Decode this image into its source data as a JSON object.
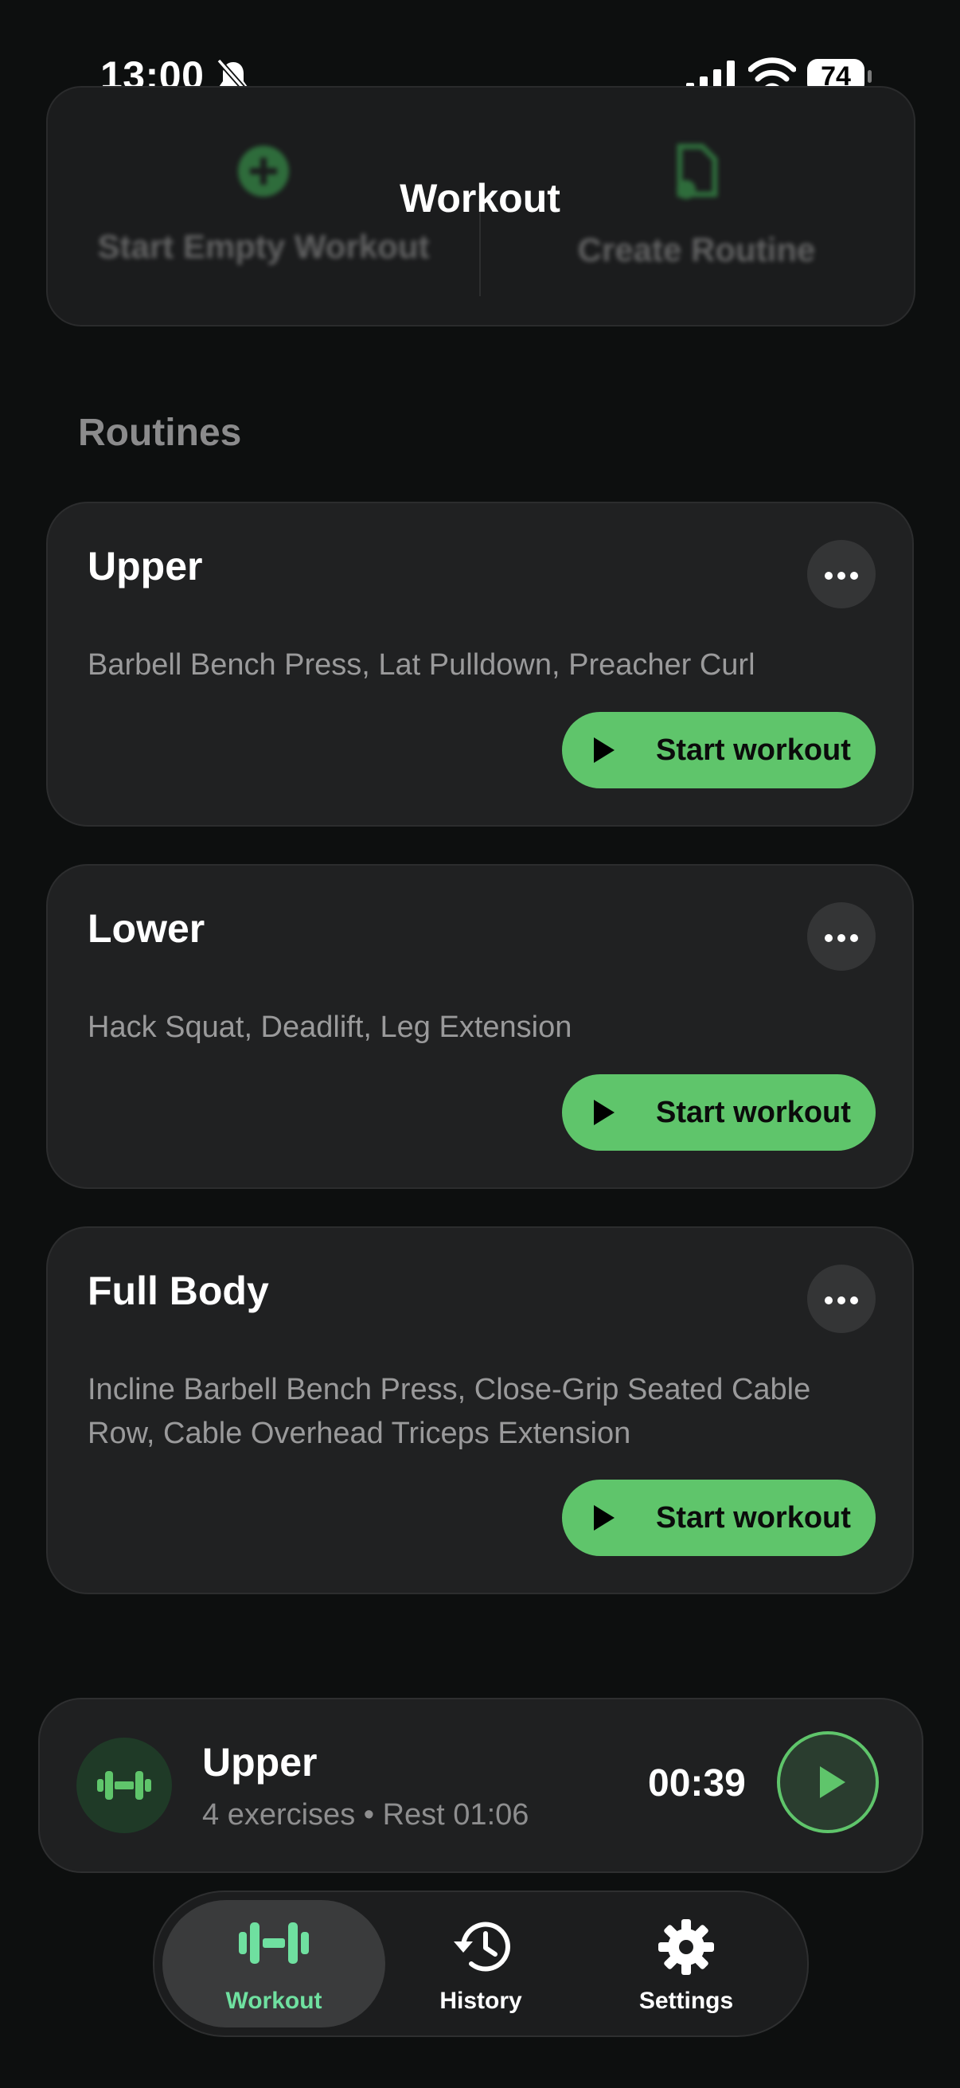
{
  "status_bar": {
    "time": "13:00",
    "battery": "74"
  },
  "header": {
    "title": "Workout",
    "quick_actions": [
      {
        "label": "Start Empty Workout",
        "icon": "plus-circle-icon"
      },
      {
        "label": "Create Routine",
        "icon": "new-document-icon"
      }
    ]
  },
  "routines_section": {
    "title": "Routines"
  },
  "routines": [
    {
      "name": "Upper",
      "exercises": "Barbell Bench Press, Lat Pulldown, Preacher Curl",
      "start_label": "Start workout"
    },
    {
      "name": "Lower",
      "exercises": "Hack Squat, Deadlift, Leg Extension",
      "start_label": "Start workout"
    },
    {
      "name": "Full Body",
      "exercises": "Incline Barbell Bench Press, Close-Grip Seated Cable Row, Cable Overhead Triceps Extension",
      "start_label": "Start workout"
    }
  ],
  "active_workout": {
    "name": "Upper",
    "details": "4 exercises • Rest 01:06",
    "timer": "00:39",
    "icon": "dumbbell-icon"
  },
  "tab_bar": {
    "tabs": [
      {
        "label": "Workout",
        "icon": "dumbbell-icon",
        "active": true
      },
      {
        "label": "History",
        "icon": "history-icon",
        "active": false
      },
      {
        "label": "Settings",
        "icon": "gear-icon",
        "active": false
      }
    ]
  },
  "colors": {
    "accent": "#5fc56b",
    "active_tab": "#6fe0a0",
    "background": "#0d0f0f",
    "card": "#202122"
  }
}
